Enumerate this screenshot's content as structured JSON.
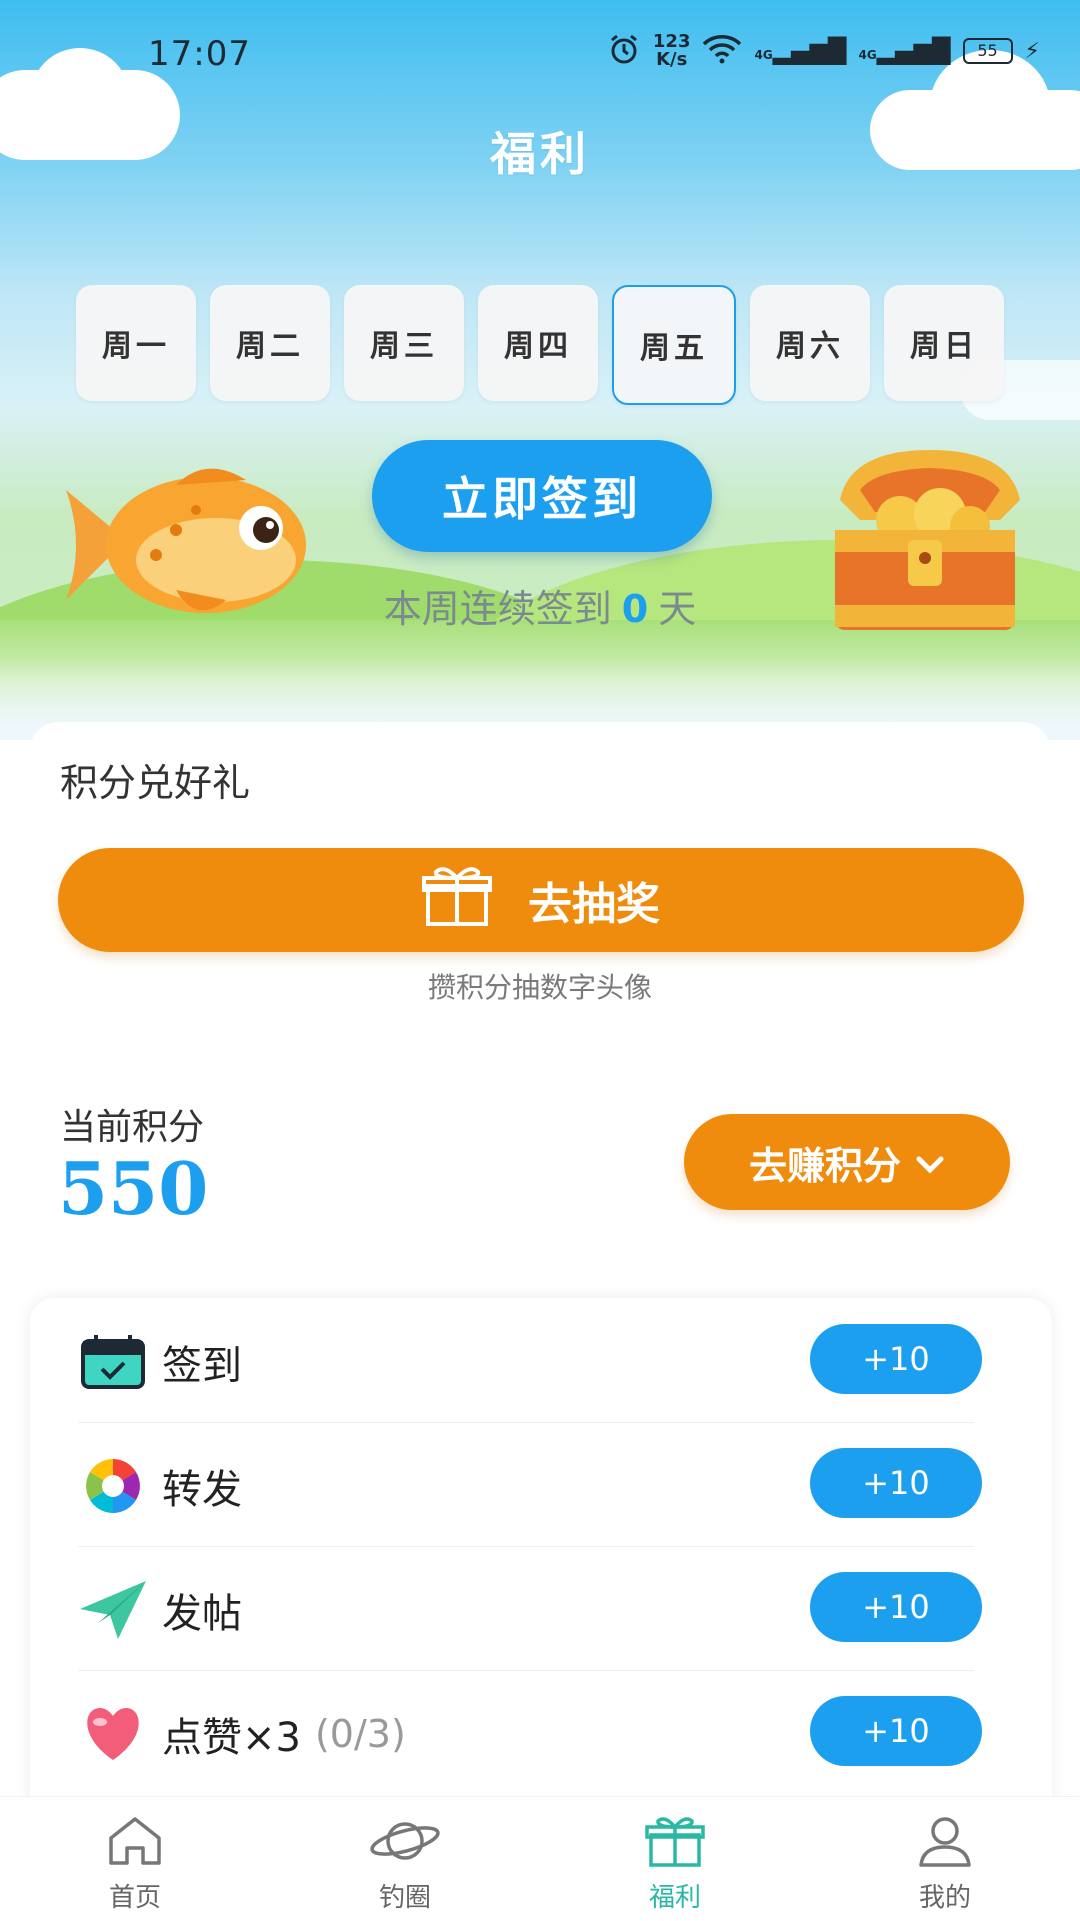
{
  "status_bar": {
    "time": "17:07",
    "net_speed_value": "123",
    "net_speed_unit": "K/s",
    "signal_1": "4G",
    "signal_2": "4G",
    "battery": "55"
  },
  "page_title": "福利",
  "weekdays": [
    {
      "label": "周一"
    },
    {
      "label": "周二"
    },
    {
      "label": "周三"
    },
    {
      "label": "周四"
    },
    {
      "label": "周五",
      "today": true
    },
    {
      "label": "周六"
    },
    {
      "label": "周日"
    }
  ],
  "checkin": {
    "button_label": "立即签到",
    "streak_prefix": "本周连续签到",
    "streak_days": "0",
    "streak_suffix": "天"
  },
  "rewards": {
    "section_title": "积分兑好礼",
    "lottery_label": "去抽奖",
    "lottery_sub": "攒积分抽数字头像"
  },
  "points": {
    "label": "当前积分",
    "value": "550",
    "earn_label": "去赚积分"
  },
  "tasks": [
    {
      "label": "签到",
      "reward": "+10",
      "icon": "calendar-icon"
    },
    {
      "label": "转发",
      "reward": "+10",
      "icon": "share-icon"
    },
    {
      "label": "发帖",
      "reward": "+10",
      "icon": "paper-plane-icon"
    },
    {
      "label": "点赞×3",
      "progress": "(0/3)",
      "reward": "+10",
      "icon": "heart-icon"
    }
  ],
  "bottom_nav": [
    {
      "label": "首页",
      "icon": "home-icon"
    },
    {
      "label": "钓圈",
      "icon": "planet-icon"
    },
    {
      "label": "福利",
      "icon": "gift-icon",
      "active": true
    },
    {
      "label": "我的",
      "icon": "user-icon"
    }
  ],
  "colors": {
    "primary_blue": "#1d9ff0",
    "orange": "#ef8c0d",
    "nav_active": "#28b8a4"
  }
}
